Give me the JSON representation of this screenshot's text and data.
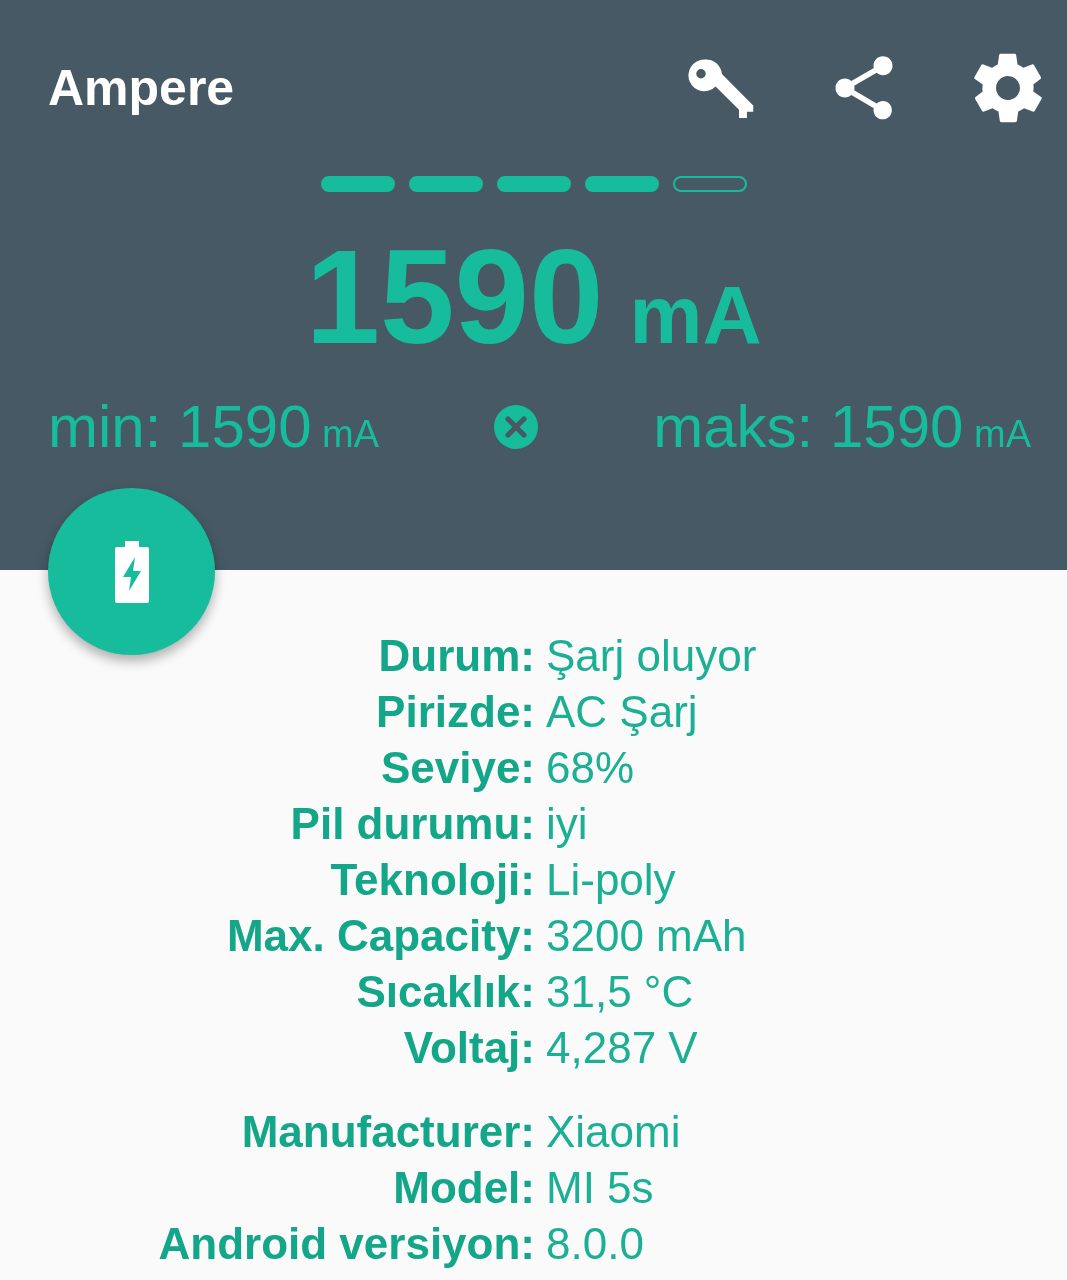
{
  "app_bar": {
    "title": "Ampere"
  },
  "meter": {
    "segments": [
      {
        "filled": true
      },
      {
        "filled": true
      },
      {
        "filled": true
      },
      {
        "filled": true
      },
      {
        "filled": false
      }
    ],
    "current": {
      "value": "1590",
      "unit": "mA"
    },
    "min": {
      "label": "min:",
      "value": "1590",
      "unit": "mA"
    },
    "max": {
      "label": "maks:",
      "value": "1590",
      "unit": "mA"
    }
  },
  "info_groups": [
    {
      "rows": [
        {
          "label": "Durum:",
          "value": "Şarj oluyor"
        },
        {
          "label": "Pirizde:",
          "value": "AC Şarj"
        },
        {
          "label": "Seviye:",
          "value": "68%"
        },
        {
          "label": "Pil durumu:",
          "value": "iyi"
        },
        {
          "label": "Teknoloji:",
          "value": "Li-poly"
        },
        {
          "label": "Max. Capacity:",
          "value": "3200 mAh"
        },
        {
          "label": "Sıcaklık:",
          "value": "31,5 °C"
        },
        {
          "label": "Voltaj:",
          "value": "4,287 V"
        }
      ]
    },
    {
      "rows": [
        {
          "label": "Manufacturer:",
          "value": "Xiaomi"
        },
        {
          "label": "Model:",
          "value": "MI 5s"
        },
        {
          "label": "Android versiyon:",
          "value": "8.0.0"
        }
      ]
    }
  ]
}
